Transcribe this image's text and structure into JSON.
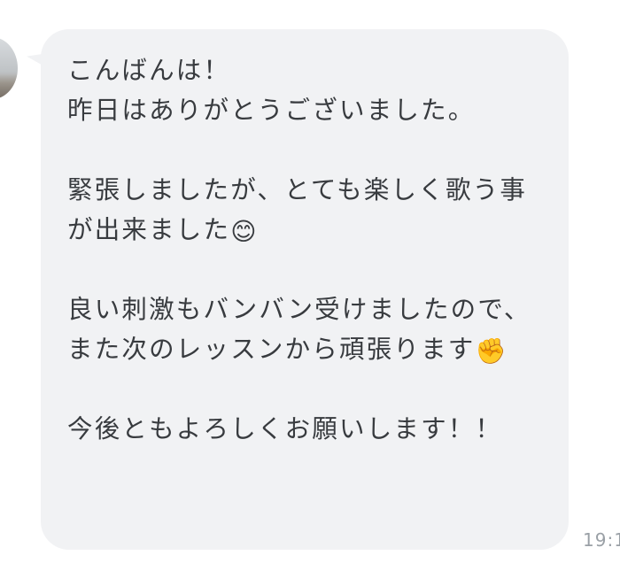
{
  "message": {
    "paragraphs": [
      {
        "text": "こんばんは！\n昨日はありがとうございました。"
      },
      {
        "text": "緊張しましたが、とても楽しく歌う事が出来ました",
        "emoji": "😊",
        "emoji_name": "smiling-face-emoji"
      },
      {
        "text": "良い刺激もバンバン受けましたので、また次のレッスンから頑張ります",
        "emoji": "✊",
        "emoji_name": "raised-fist-emoji"
      },
      {
        "text": "今後ともよろしくお願いします！！"
      }
    ],
    "timestamp": "19:1"
  },
  "colors": {
    "bubble_background": "#f1f2f4",
    "text": "#383b3f",
    "timestamp": "#9aa0a6"
  }
}
